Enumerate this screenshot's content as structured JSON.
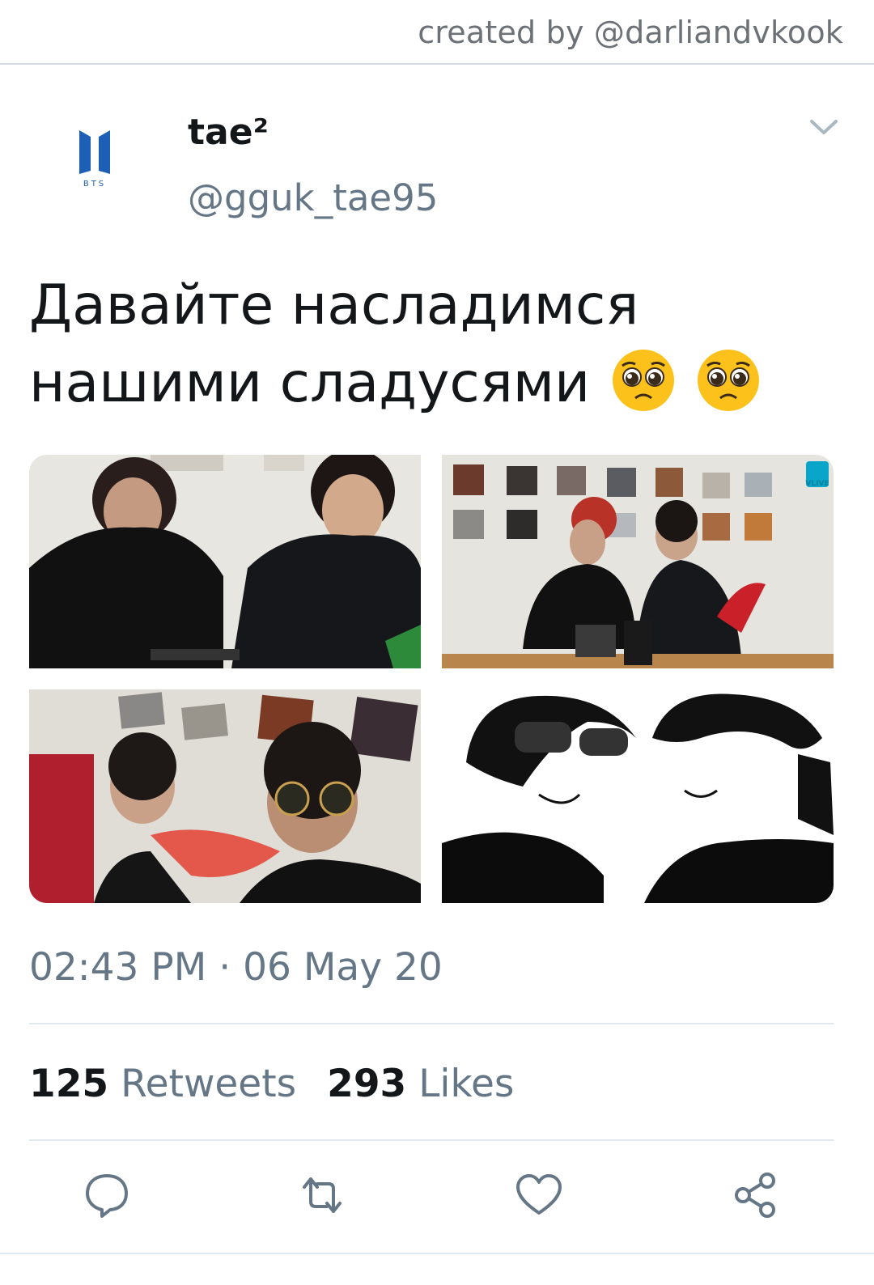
{
  "credit": "created by @darliandvkook",
  "user": {
    "display_name": "tae²",
    "handle": "@gguk_tae95",
    "avatar_text": "BTS"
  },
  "tweet": {
    "text": "Давайте насладимся нашими сладусями",
    "emojis": [
      "pleading-face",
      "pleading-face"
    ]
  },
  "media": [
    {
      "name": "photo-1"
    },
    {
      "name": "photo-2",
      "badge": "VLIVE"
    },
    {
      "name": "photo-3"
    },
    {
      "name": "photo-4"
    }
  ],
  "timestamp": "02:43 PM · 06 May 20",
  "stats": {
    "retweets_count": "125",
    "retweets_label": "Retweets",
    "likes_count": "293",
    "likes_label": "Likes"
  },
  "actions": [
    "reply-icon",
    "retweet-icon",
    "like-icon",
    "share-icon"
  ],
  "colors": {
    "text": "#14171a",
    "secondary": "#657786",
    "divider": "#e1e8ed",
    "bts_blue": "#1d5fb4"
  }
}
